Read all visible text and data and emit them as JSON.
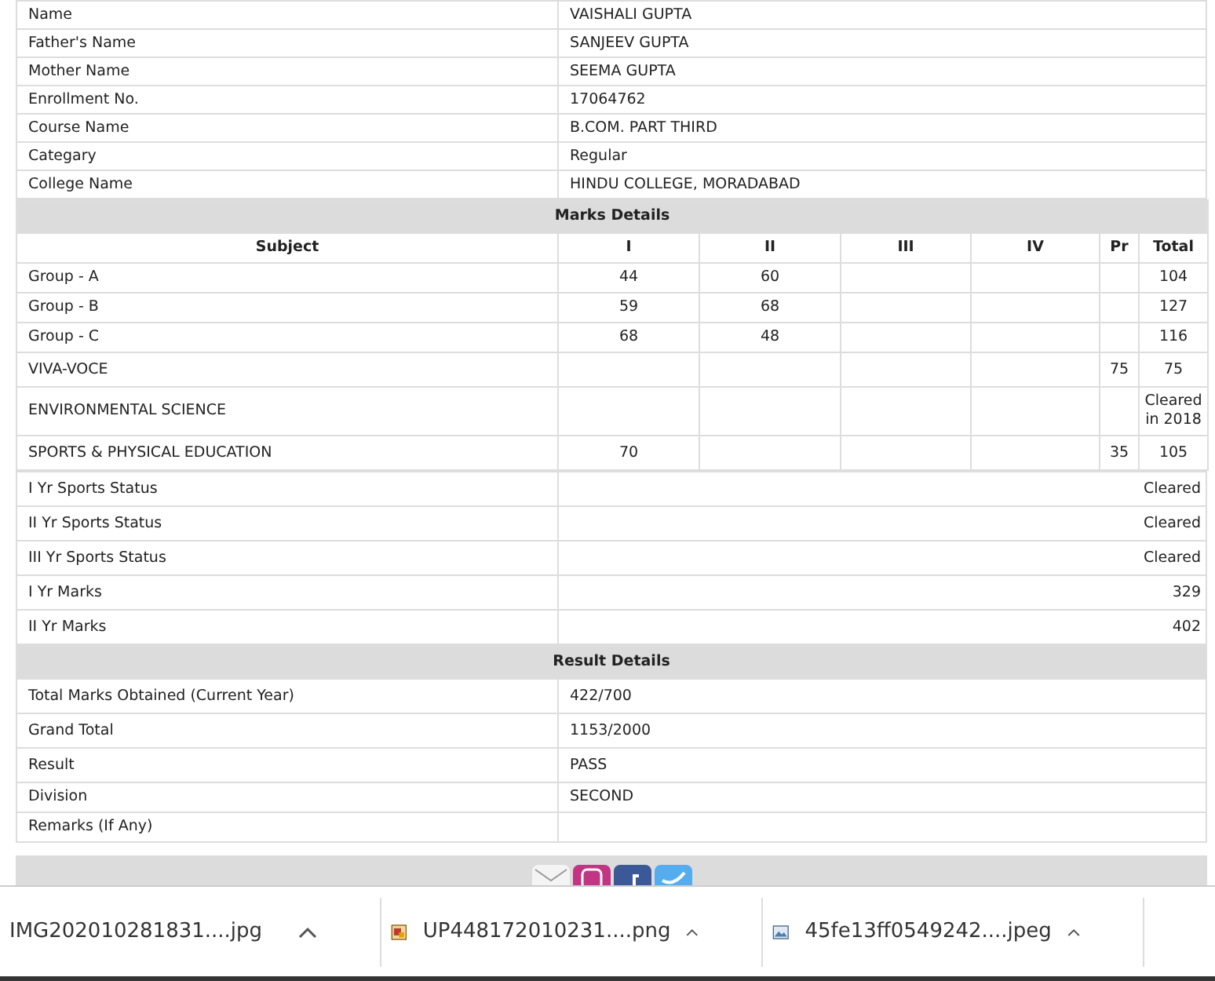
{
  "student": [
    {
      "label": "Name",
      "value": "VAISHALI GUPTA"
    },
    {
      "label": "Father's Name",
      "value": "SANJEEV GUPTA"
    },
    {
      "label": "Mother Name",
      "value": "SEEMA GUPTA"
    },
    {
      "label": "Enrollment No.",
      "value": "17064762"
    },
    {
      "label": "Course Name",
      "value": "B.COM. PART THIRD"
    },
    {
      "label": "Categary",
      "value": "Regular"
    },
    {
      "label": "College Name",
      "value": "HINDU COLLEGE, MORADABAD"
    }
  ],
  "marks": {
    "title": "Marks Details",
    "columns": [
      "Subject",
      "I",
      "II",
      "III",
      "IV",
      "Pr",
      "Total"
    ],
    "rows": [
      {
        "kind": "marks",
        "cells": [
          "Group - A",
          "44",
          "60",
          "",
          "",
          "",
          "104"
        ]
      },
      {
        "kind": "marks",
        "cells": [
          "Group - B",
          "59",
          "68",
          "",
          "",
          "",
          "127"
        ]
      },
      {
        "kind": "marks",
        "cells": [
          "Group - C",
          "68",
          "48",
          "",
          "",
          "",
          "116"
        ]
      },
      {
        "kind": "marks",
        "cells": [
          "VIVA-VOCE",
          "",
          "",
          "",
          "",
          "75",
          "75"
        ]
      },
      {
        "kind": "marks",
        "cells": [
          "ENVIRONMENTAL SCIENCE",
          "",
          "",
          "",
          "",
          "",
          "Cleared in 2018"
        ]
      },
      {
        "kind": "marks",
        "cells": [
          "SPORTS & PHYSICAL EDUCATION",
          "70",
          "",
          "",
          "",
          "35",
          "105"
        ]
      }
    ]
  },
  "summary": [
    {
      "label": "I Yr Sports Status",
      "value": "Cleared"
    },
    {
      "label": "II Yr Sports Status",
      "value": "Cleared"
    },
    {
      "label": "III Yr Sports Status",
      "value": "Cleared"
    },
    {
      "label": "I Yr Marks",
      "value": "329"
    },
    {
      "label": "II Yr Marks",
      "value": "402"
    }
  ],
  "result": {
    "title": "Result Details",
    "rows": [
      {
        "label": "Total Marks Obtained (Current Year)",
        "value": "422/700"
      },
      {
        "label": "Grand Total",
        "value": "1153/2000"
      },
      {
        "label": "Result",
        "value": "PASS"
      },
      {
        "label": "Division",
        "value": "SECOND"
      },
      {
        "label": "Remarks (If Any)",
        "value": ""
      }
    ]
  },
  "downloads": [
    {
      "kind": "plain",
      "filename": "IMG202010281831....jpg"
    },
    {
      "kind": "png",
      "filename": "UP448172010231....png"
    },
    {
      "kind": "image",
      "filename": "45fe13ff0549242....jpeg"
    }
  ]
}
